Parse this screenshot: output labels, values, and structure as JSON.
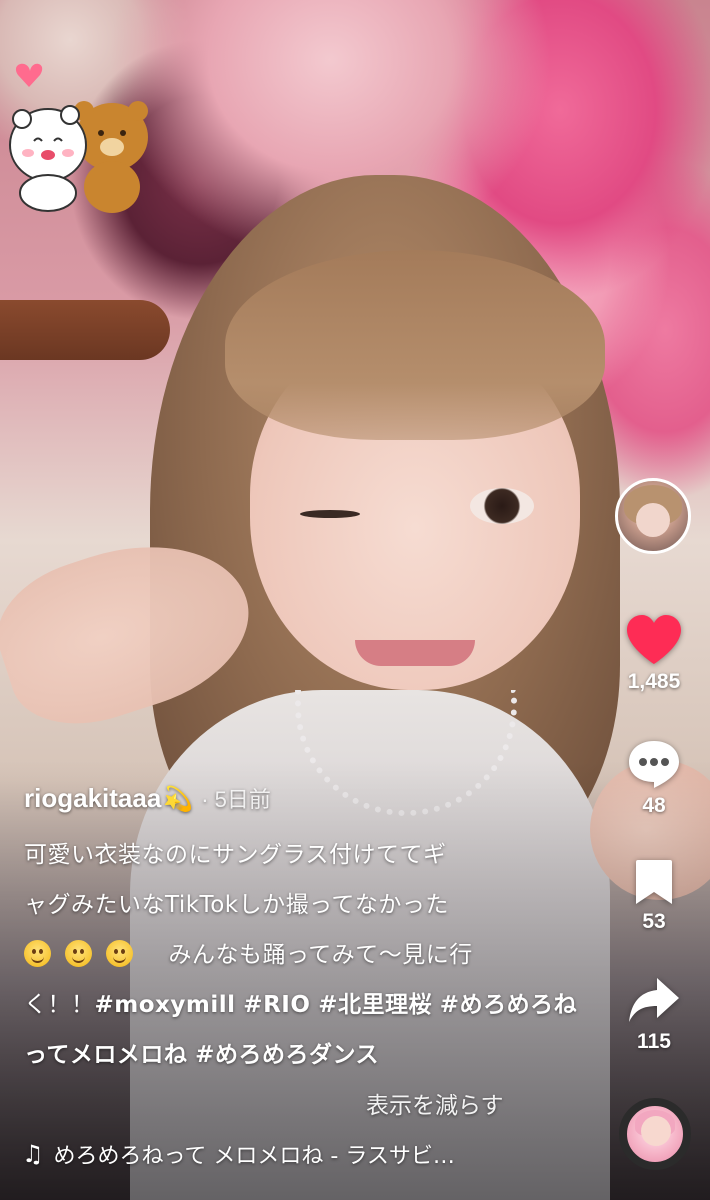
{
  "post": {
    "username": "riogakitaaa",
    "username_emoji": "💫",
    "time_ago": "· 5日前",
    "caption": {
      "line1": "可愛い衣装なのにサングラス付けててギ",
      "line2": "ャグみたいなTikTokしか撮ってなかった",
      "line3_text": "みんなも踊ってみて〜見に行",
      "line4_prefix": "く！！",
      "hashtags": [
        "#moxymill",
        "#RIO",
        "#北里理桜",
        "#めろめろねってメロメロね",
        "#めろめろダンス"
      ],
      "emoji_names": [
        "slightly-smiling-face",
        "slightly-smiling-face",
        "slightly-smiling-face"
      ]
    },
    "show_less_label": "表示を減らす",
    "music": {
      "icon": "music-note-icon",
      "title": "めろめろねって メロメロね - ラスサビ…"
    }
  },
  "actions": {
    "like": {
      "count": "1,485",
      "color": "#fe2c55",
      "icon": "heart-icon"
    },
    "comment": {
      "count": "48",
      "icon": "comment-bubble-icon"
    },
    "save": {
      "count": "53",
      "icon": "bookmark-icon"
    },
    "share": {
      "count": "115",
      "icon": "share-arrow-icon"
    }
  }
}
